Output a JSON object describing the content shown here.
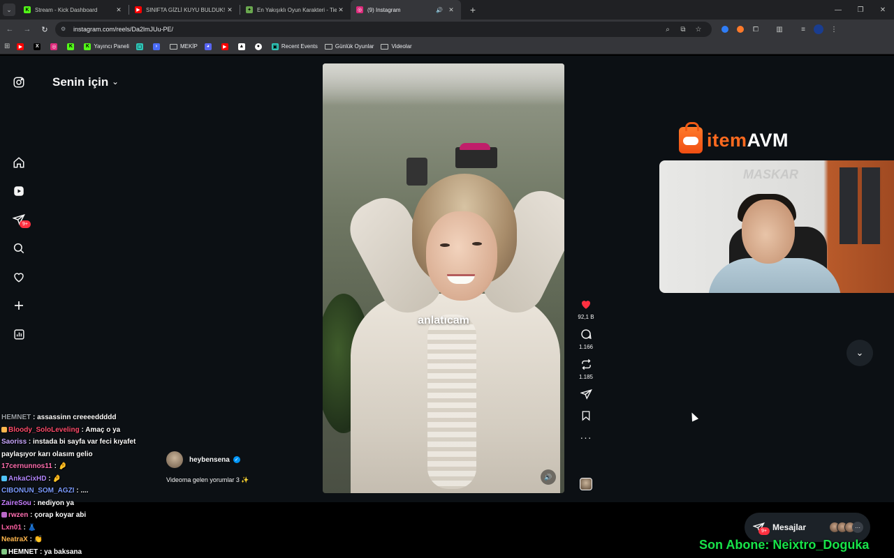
{
  "browser": {
    "tabs": [
      {
        "title": "Stream - Kick Dashboard",
        "favicon": "K",
        "color": "#53fc18",
        "active": false
      },
      {
        "title": "SINIFTA GİZLİ KUYU BULDUK! 😮",
        "favicon": "▶",
        "color": "#ff0000",
        "active": false
      },
      {
        "title": "En Yakışıklı Oyun Karakteri - Tie",
        "favicon": "✦",
        "color": "#6aa84f",
        "active": false
      },
      {
        "title": "(9) Instagram",
        "favicon": "◎",
        "color": "#dd2a7b",
        "active": true
      }
    ],
    "new_tab": "+",
    "url": "instagram.com/reels/Da2lmJUu-PE/",
    "bookmarks": [
      {
        "label": "",
        "icon": "youtube-icon",
        "color": "#ff0000"
      },
      {
        "label": "",
        "icon": "x-icon",
        "color": "#ffffff"
      },
      {
        "label": "",
        "icon": "instagram-icon",
        "color": "#dd2a7b"
      },
      {
        "label": "",
        "icon": "kick-icon",
        "color": "#53fc18"
      },
      {
        "label": "Yayıncı Paneli",
        "icon": "kick-icon",
        "color": "#53fc18"
      },
      {
        "label": "",
        "icon": "chat-icon",
        "color": "#2ec4b6"
      },
      {
        "label": "",
        "icon": "terminal-icon",
        "color": "#4a6cf7"
      },
      {
        "label": "MEKİP",
        "icon": "folder-icon",
        "color": ""
      },
      {
        "label": "",
        "icon": "discord-icon",
        "color": "#5865f2"
      },
      {
        "label": "",
        "icon": "youtube-icon",
        "color": "#ff0000"
      },
      {
        "label": "",
        "icon": "image-icon",
        "color": "#ffffff"
      },
      {
        "label": "",
        "icon": "circle-icon",
        "color": "#ffffff"
      },
      {
        "label": "Recent Events",
        "icon": "events-icon",
        "color": "#2ec4b6"
      },
      {
        "label": "Günlük Oyunlar",
        "icon": "folder-icon",
        "color": ""
      },
      {
        "label": "Videolar",
        "icon": "folder-icon",
        "color": ""
      }
    ]
  },
  "instagram": {
    "feed_title": "Senin için",
    "messages_badge": "9+",
    "reel": {
      "overlay_text": "anlatıcam",
      "author": "heybensena",
      "caption": "Videoma gelen yorumlar 3 ✨",
      "likes": "92,1 B",
      "comments": "1.166",
      "reposts": "1.185"
    },
    "messages_label": "Mesajlar",
    "messages_count": "9+"
  },
  "overlay": {
    "sponsor_part1": "item",
    "sponsor_part2": "AVM",
    "webcam_watermark": "MASKAR",
    "sub_ticker": "Son Abone: Neixtro_Doguka",
    "chat": [
      {
        "user": "HEMNET",
        "user_color": "#9aa0a6",
        "text": "assassinn creeeeddddd"
      },
      {
        "user": "Bloody_SoloLeveling",
        "user_color": "#ff4d6d",
        "text": "Amaç o ya"
      },
      {
        "user": "Saoriss",
        "user_color": "#c9a8ff",
        "text": "instada bi sayfa var feci kıyafet paylaşıyor karı olasım gelio"
      },
      {
        "user": "17cernunnos11",
        "user_color": "#ff6fb1",
        "text": "🤌"
      },
      {
        "user": "AnkaCixHD",
        "user_color": "#b388ff",
        "text": "🤌"
      },
      {
        "user": "CIBONUN_SOM_AGZI",
        "user_color": "#7c9cff",
        "text": "...."
      },
      {
        "user": "ZaireSou",
        "user_color": "#c77dff",
        "text": "nediyon ya"
      },
      {
        "user": "rwzen",
        "user_color": "#ff6fb1",
        "text": "çorap koyar abi"
      },
      {
        "user": "Lxn01",
        "user_color": "#ff5fa2",
        "text": "👗"
      },
      {
        "user": "NeatraX",
        "user_color": "#ffb74d",
        "text": "👏"
      },
      {
        "user": "HEMNET",
        "user_color": "#ffffff",
        "text": "ya baksana"
      }
    ]
  }
}
